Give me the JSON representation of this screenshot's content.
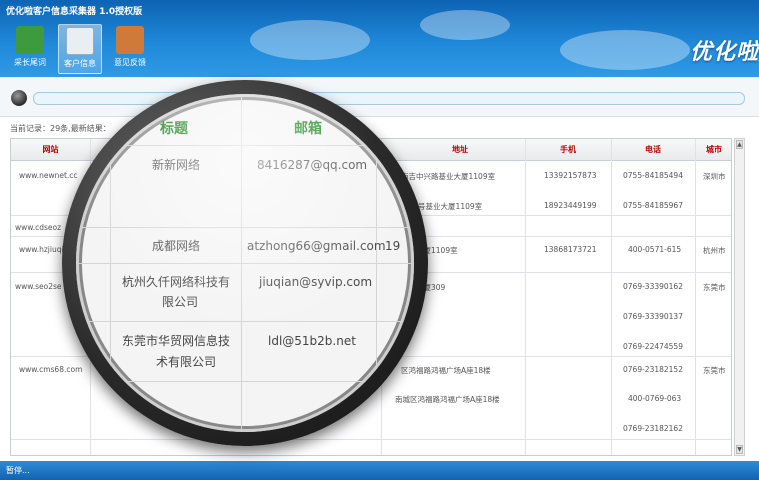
{
  "app": {
    "title": "优化啦客户信息采集器 1.0授权版",
    "brand": "优化啦"
  },
  "toolbar": [
    {
      "label": "采长尾词",
      "icon": "keyword-collect-icon"
    },
    {
      "label": "客户信息",
      "icon": "customer-info-icon",
      "active": true
    },
    {
      "label": "意见反馈",
      "icon": "feedback-icon"
    }
  ],
  "url_input": {
    "value": ""
  },
  "record_info": "当前记录：29条,最新结果：",
  "grid": {
    "columns": [
      "网站",
      "标题",
      "邮箱",
      "地址",
      "手机",
      "电话",
      "城市"
    ],
    "rows": [
      {
        "site": "www.newnet.cc",
        "addr1": "南吉中兴路基业大厦1109室",
        "addr2": "路21号基业大厦1109室",
        "mobile1": "13392157873",
        "mobile2": "18923449199",
        "phone1": "0755-84185494",
        "phone2": "0755-84185967",
        "city": "深圳市"
      },
      {
        "site": "www.cdseoz"
      },
      {
        "site": "www.hzjiuqi",
        "site_suffix": "m",
        "addr_prefix": "19",
        "addr1": "沿江大厦1109室",
        "mobile1": "13868173721",
        "phone1": "400-0571-615",
        "city": "杭州市"
      },
      {
        "site": "www.seo2se",
        "site_suffix": "et",
        "addr1": "商合大厦309",
        "phone1": "0769-33390162",
        "phone2": "0769-33390137",
        "phone3": "0769-22474559",
        "city": "东莞市"
      },
      {
        "site": "www.cms68.com",
        "addr1": "区鸿福路鸿福广场A座18楼",
        "addr2": "南城区鸿福路鸿福广场A座18楼",
        "phone1": "0769-23182152",
        "phone2": "400-0769-063",
        "phone3": "0769-23182162",
        "city": "东莞市"
      }
    ]
  },
  "magnifier": {
    "headers": [
      "标题",
      "邮箱"
    ],
    "rows": [
      {
        "title": "新新网络",
        "email": "8416287@qq.com"
      },
      {
        "title": "成都网络",
        "email": "atzhong66@gmail.com",
        "tail": "19"
      },
      {
        "title_line1": "杭州久仟网络科技有",
        "title_line2": "限公司",
        "email": "jiuqian@syvip.com"
      },
      {
        "title_line1": "东莞市华贸网信息技",
        "title_line2": "术有限公司",
        "email": "ldl@51b2b.net"
      }
    ]
  },
  "status": "暂停..."
}
